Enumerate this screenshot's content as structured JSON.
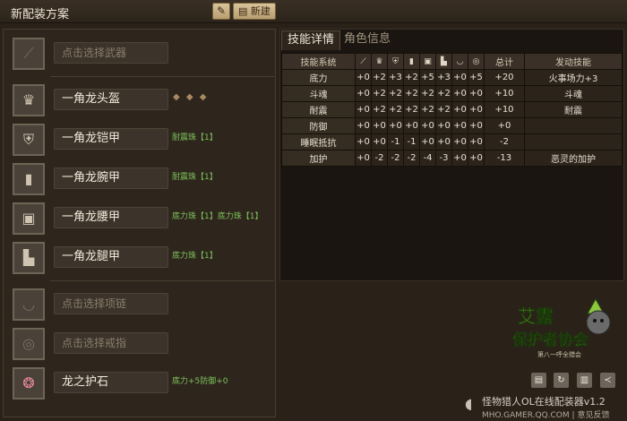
{
  "header": {
    "title": "新配装方案",
    "edit_icon": "pencil-icon",
    "new_label": "新建"
  },
  "slots": [
    {
      "icon": "weapon-icon",
      "label": "点击选择武器",
      "empty": true
    },
    {
      "icon": "helmet-icon",
      "label": "一角龙头盔",
      "empty": false,
      "decorations": "◆ ◆ ◆",
      "note": ""
    },
    {
      "icon": "chest-icon",
      "label": "一角龙铠甲",
      "empty": false,
      "note": "耐震珠【1】"
    },
    {
      "icon": "arm-icon",
      "label": "一角龙腕甲",
      "empty": false,
      "note": "耐震珠【1】"
    },
    {
      "icon": "waist-icon",
      "label": "一角龙腰甲",
      "empty": false,
      "note": "底力珠【1】底力珠【1】"
    },
    {
      "icon": "leg-icon",
      "label": "一角龙腿甲",
      "empty": false,
      "note": "底力珠【1】"
    },
    {
      "icon": "necklace-icon",
      "label": "点击选择项链",
      "empty": true
    },
    {
      "icon": "ring-icon",
      "label": "点击选择戒指",
      "empty": true
    },
    {
      "icon": "charm-icon",
      "label": "龙之护石",
      "empty": false,
      "note": "底力+5防御+0"
    }
  ],
  "tabs": [
    {
      "label": "技能详情",
      "active": true
    },
    {
      "label": "角色信息",
      "active": false
    }
  ],
  "table": {
    "col_skill": "技能系统",
    "col_total": "总计",
    "col_active": "发动技能",
    "equip_icons": [
      "weapon-icon",
      "helmet-icon",
      "chest-icon",
      "arm-icon",
      "waist-icon",
      "leg-icon",
      "necklace-icon",
      "ring-icon"
    ],
    "rows": [
      {
        "name": "底力",
        "vals": [
          "+0",
          "+2",
          "+3",
          "+2",
          "+5",
          "+3",
          "+0",
          "+5"
        ],
        "total": "+20",
        "active": "火事场力+3"
      },
      {
        "name": "斗魂",
        "vals": [
          "+0",
          "+2",
          "+2",
          "+2",
          "+2",
          "+2",
          "+0",
          "+0"
        ],
        "total": "+10",
        "active": "斗魂"
      },
      {
        "name": "耐震",
        "vals": [
          "+0",
          "+2",
          "+2",
          "+2",
          "+2",
          "+2",
          "+0",
          "+0"
        ],
        "total": "+10",
        "active": "耐震"
      },
      {
        "name": "防御",
        "vals": [
          "+0",
          "+0",
          "+0",
          "+0",
          "+0",
          "+0",
          "+0",
          "+0"
        ],
        "total": "+0",
        "active": ""
      },
      {
        "name": "睡眠抵抗",
        "vals": [
          "+0",
          "+0",
          "-1",
          "-1",
          "+0",
          "+0",
          "+0",
          "+0"
        ],
        "total": "-2",
        "active": ""
      },
      {
        "name": "加护",
        "vals": [
          "+0",
          "-2",
          "-2",
          "-2",
          "-4",
          "-3",
          "+0",
          "+0"
        ],
        "total": "-13",
        "active": "恶灵的加护"
      }
    ]
  },
  "logo": {
    "line1": "艾露",
    "line2": "保护者协会",
    "sub": "第八一呼全猎会"
  },
  "toolbar": [
    "save-icon",
    "refresh-icon",
    "trash-icon",
    "share-icon"
  ],
  "footer": {
    "title": "怪物猎人OL在线配装器v1.2",
    "site": "MHO.GAMER.QQ.COM",
    "sep": "|",
    "feedback": "意见反馈"
  }
}
